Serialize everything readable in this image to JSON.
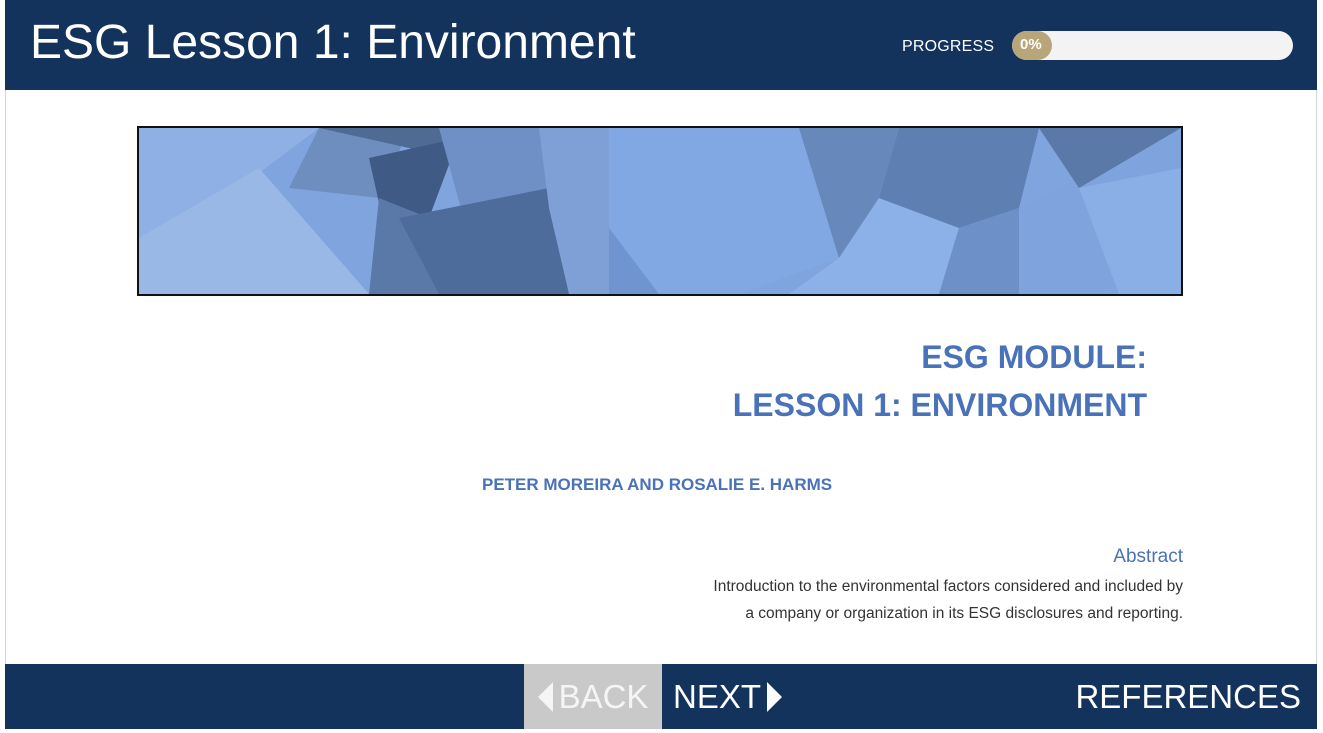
{
  "header": {
    "title": "ESG Lesson 1: Environment",
    "progress_label": "PROGRESS",
    "progress_text": "0%",
    "progress_value": 0
  },
  "banner": {
    "image": "abstract-blue-geometric-banner"
  },
  "content": {
    "module_line1": "ESG MODULE:",
    "module_line2": "LESSON 1: ENVIRONMENT",
    "authors": "PETER MOREIRA AND ROSALIE E. HARMS",
    "abstract_heading": "Abstract",
    "abstract_line1": "Introduction to the environmental factors considered and included by",
    "abstract_line2": "a company or organization in its ESG disclosures and reporting."
  },
  "footer": {
    "back_label": "BACK",
    "next_label": "NEXT",
    "references_label": "REFERENCES"
  },
  "colors": {
    "header_bg": "#13325c",
    "accent_blue": "#4a72b8",
    "progress_fill": "#b9a57a",
    "back_disabled": "#c9c9c9"
  },
  "icons": {
    "back": "triangle-left-icon",
    "next": "triangle-right-icon"
  }
}
